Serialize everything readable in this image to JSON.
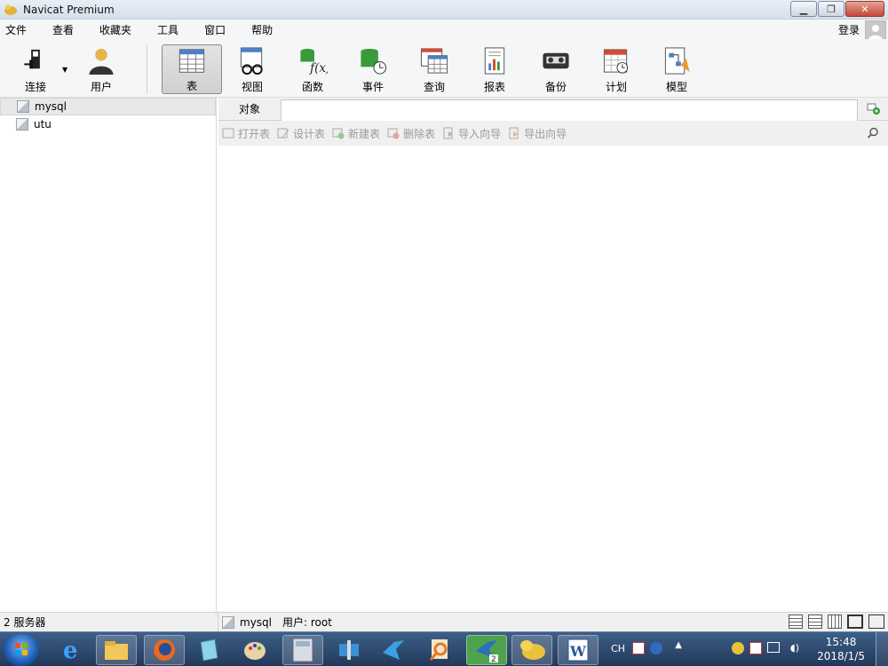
{
  "window": {
    "title": "Navicat Premium"
  },
  "menu": {
    "items": [
      "文件",
      "查看",
      "收藏夹",
      "工具",
      "窗口",
      "帮助"
    ],
    "login": "登录"
  },
  "toolbar": {
    "connect": "连接",
    "user": "用户",
    "table": "表",
    "view": "视图",
    "function": "函数",
    "event": "事件",
    "query": "查询",
    "report": "报表",
    "backup": "备份",
    "schedule": "计划",
    "model": "模型"
  },
  "tree": {
    "items": [
      "mysql",
      "utu"
    ]
  },
  "right": {
    "tab_label": "对象",
    "actions": [
      "打开表",
      "设计表",
      "新建表",
      "删除表",
      "导入向导",
      "导出向导"
    ]
  },
  "status": {
    "servers": "2 服务器",
    "db": "mysql",
    "user": "用户: root"
  },
  "taskbar": {
    "ime": "CH",
    "time": "15:48",
    "date": "2018/1/5",
    "badge": "2"
  },
  "colors": {
    "accent_green": "#3a9a3a",
    "brand": "#2f6bbf"
  }
}
